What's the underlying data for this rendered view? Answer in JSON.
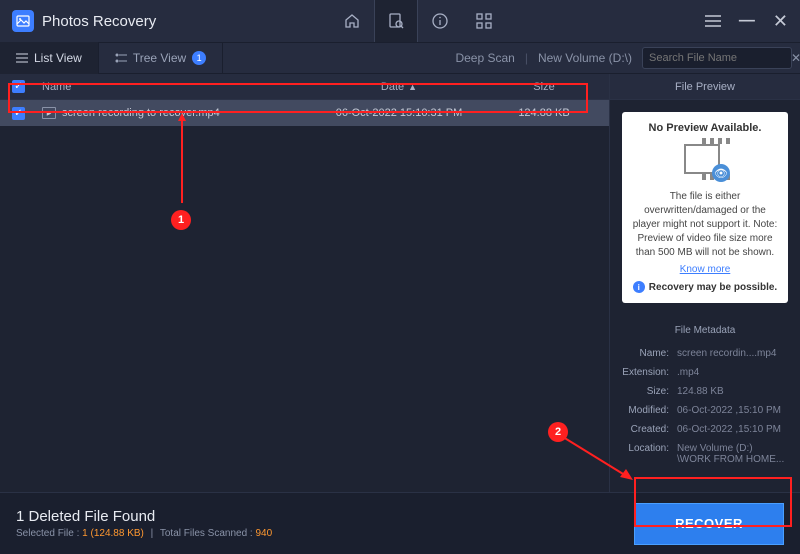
{
  "app": {
    "title": "Photos Recovery"
  },
  "subbar": {
    "listView": "List View",
    "treeView": "Tree View",
    "treeBadge": "1",
    "deepScan": "Deep Scan",
    "volume": "New Volume (D:\\)",
    "searchPlaceholder": "Search File Name"
  },
  "columns": {
    "name": "Name",
    "date": "Date",
    "size": "Size"
  },
  "file": {
    "name": "screen recording to recover.mp4",
    "date": "06-Oct-2022 15:10:31 PM",
    "size": "124.88 KB"
  },
  "preview": {
    "header": "File Preview",
    "noPreview": "No Preview Available.",
    "desc": "The file is either overwritten/damaged or the player might not support it. Note: Preview of video file size more than 500 MB will not be shown.",
    "knowMore": "Know more",
    "possible": "Recovery may be possible."
  },
  "metadata": {
    "header": "File Metadata",
    "name": {
      "label": "Name:",
      "value": "screen recordin....mp4"
    },
    "ext": {
      "label": "Extension:",
      "value": ".mp4"
    },
    "size": {
      "label": "Size:",
      "value": "124.88 KB"
    },
    "modified": {
      "label": "Modified:",
      "value": "06-Oct-2022 ,15:10 PM"
    },
    "created": {
      "label": "Created:",
      "value": "06-Oct-2022 ,15:10 PM"
    },
    "location": {
      "label": "Location:",
      "value": "New Volume (D:) \\WORK FROM HOME..."
    }
  },
  "footer": {
    "title": "1 Deleted File Found",
    "selectedLabel": "Selected File :",
    "selectedCount": "1",
    "selectedSize": "(124.88 KB)",
    "totalLabel": "Total Files Scanned :",
    "totalCount": "940",
    "recoverBtn": "RECOVER"
  },
  "annotations": {
    "badge1": "1",
    "badge2": "2"
  }
}
